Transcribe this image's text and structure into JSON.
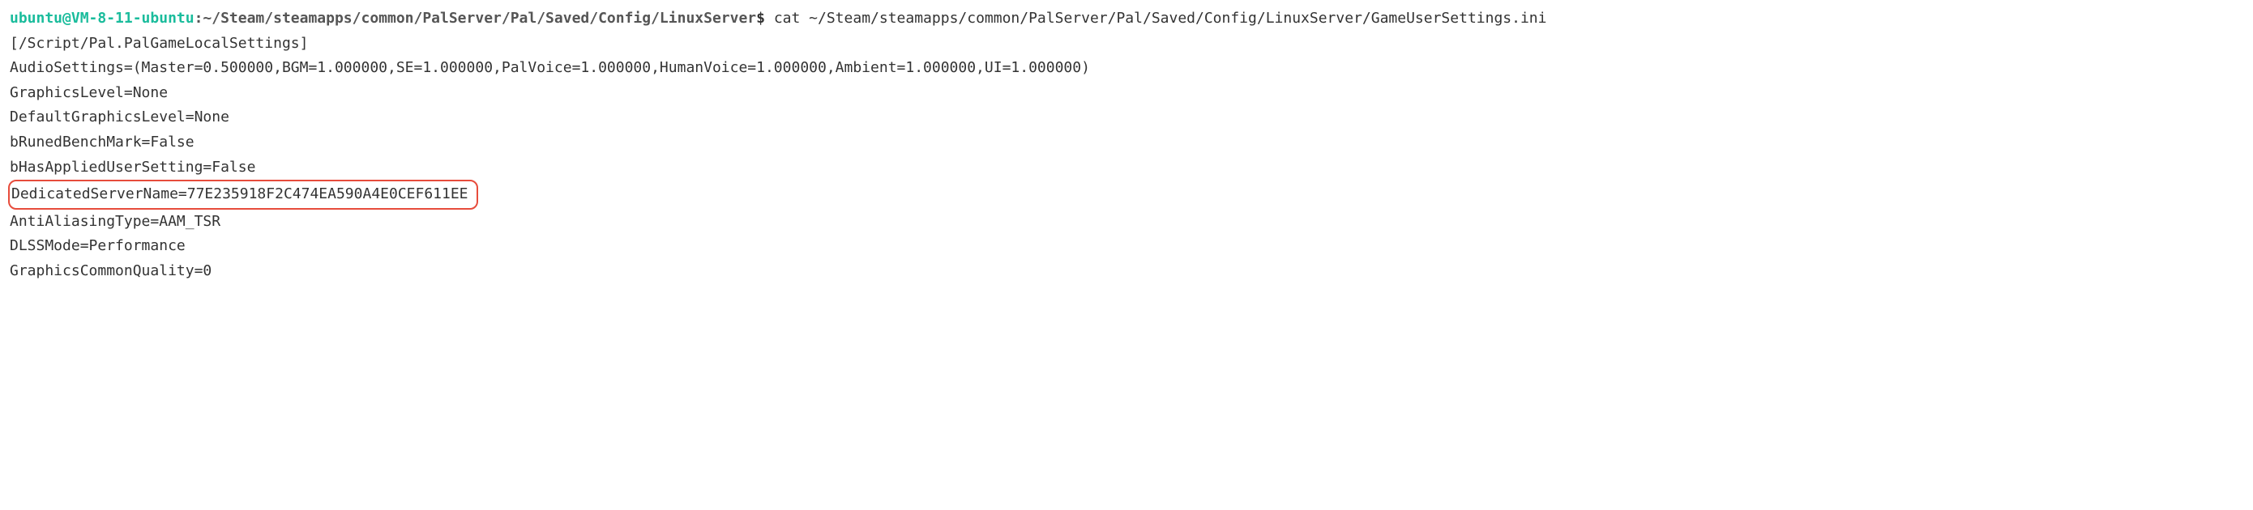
{
  "prompt": {
    "user": "ubuntu@VM-8-11-ubuntu",
    "path": ":~/Steam/steamapps/common/PalServer/Pal/Saved/Config/LinuxServer",
    "symbol": "$"
  },
  "command": "cat ~/Steam/steamapps/common/PalServer/Pal/Saved/Config/LinuxServer/GameUserSettings.ini",
  "output": [
    "[/Script/Pal.PalGameLocalSettings]",
    "AudioSettings=(Master=0.500000,BGM=1.000000,SE=1.000000,PalVoice=1.000000,HumanVoice=1.000000,Ambient=1.000000,UI=1.000000)",
    "GraphicsLevel=None",
    "DefaultGraphicsLevel=None",
    "bRunedBenchMark=False",
    "bHasAppliedUserSetting=False",
    "DedicatedServerName=77E235918F2C474EA590A4E0CEF611EE",
    "AntiAliasingType=AAM_TSR",
    "DLSSMode=Performance",
    "GraphicsCommonQuality=0"
  ],
  "highlight_color": "#e74c3c"
}
